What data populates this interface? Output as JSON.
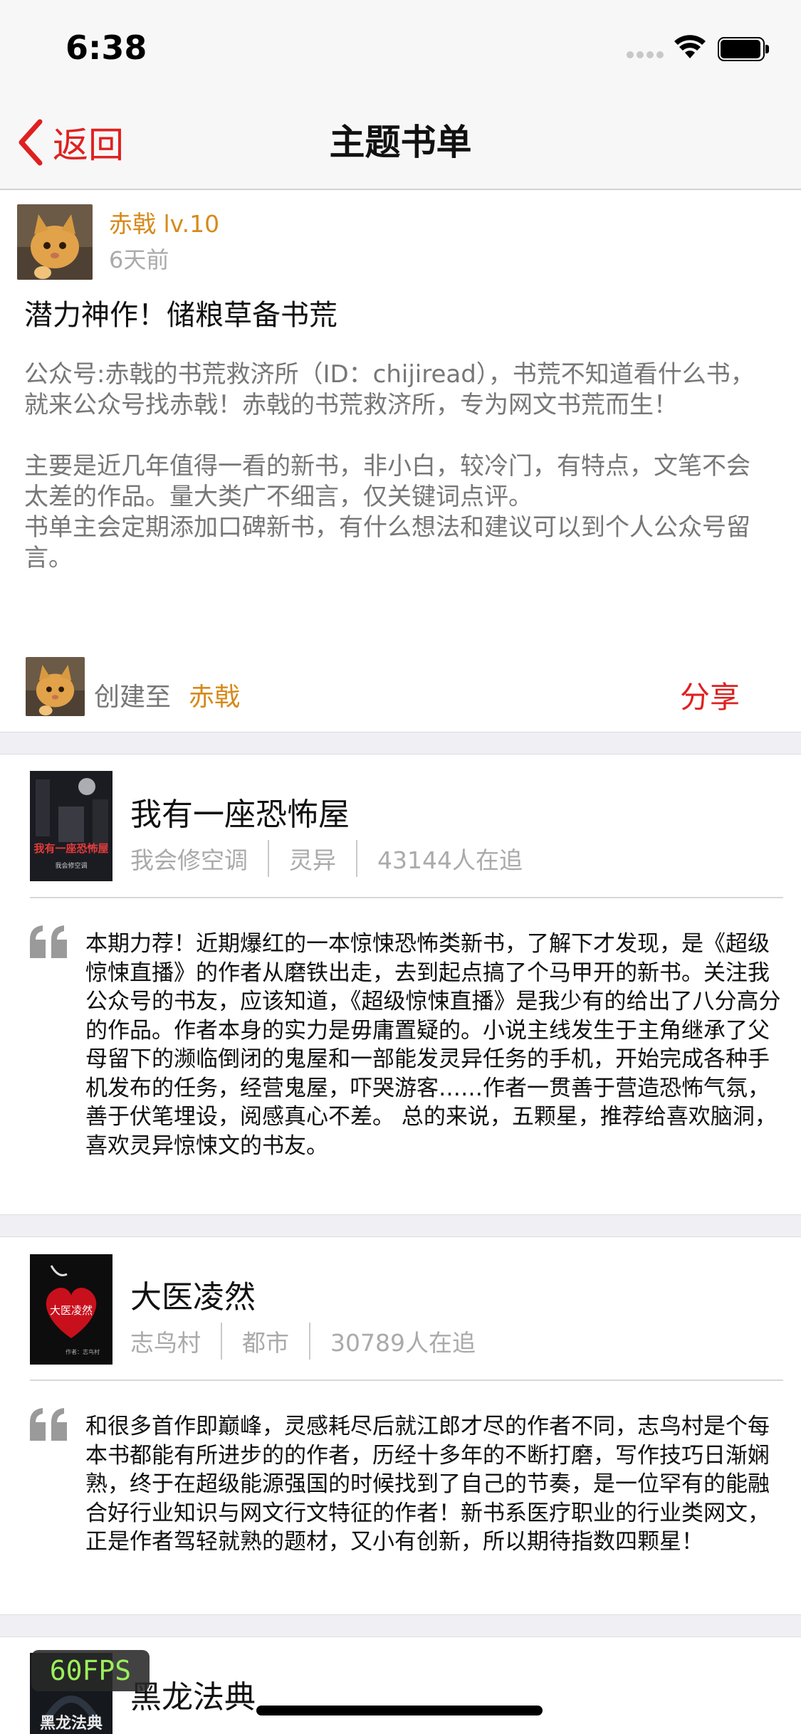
{
  "status_bar": {
    "time": "6:38"
  },
  "nav": {
    "back_label": "返回",
    "title": "主题书单"
  },
  "header": {
    "user_name": "赤戟 lv.10",
    "time_ago": "6天前",
    "list_title": "潜力神作！储粮草备书荒",
    "description": [
      "公众号:赤戟的书荒救济所（ID：chijiread），书荒不知道看什么书，就来公众号找赤戟！赤戟的书荒救济所，专为网文书荒而生！",
      "主要是近几年值得一看的新书，非小白，较冷门，有特点，文笔不会太差的作品。量大类广不细言，仅关键词点评。",
      "书单主会定期添加口碑新书，有什么想法和建议可以到个人公众号留言。"
    ],
    "created_label": "创建至",
    "creator": "赤戟",
    "share_label": "分享"
  },
  "books": [
    {
      "title": "我有一座恐怖屋",
      "author": "我会修空调",
      "category": "灵异",
      "followers": "43144人在追",
      "cover_text": "我有一座恐怖屋",
      "cover_sub": "我会修空调",
      "review": "本期力荐！近期爆红的一本惊悚恐怖类新书，了解下才发现，是《超级惊悚直播》的作者从磨铁出走，去到起点搞了个马甲开的新书。关注我公众号的书友，应该知道，《超级惊悚直播》是我少有的给出了八分高分的作品。作者本身的实力是毋庸置疑的。小说主线发生于主角继承了父母留下的濒临倒闭的鬼屋和一部能发灵异任务的手机，开始完成各种手机发布的任务，经营鬼屋，吓哭游客……作者一贯善于营造恐怖气氛，善于伏笔埋设，阅感真心不差。 总的来说，五颗星，推荐给喜欢脑洞，喜欢灵异惊悚文的书友。"
    },
    {
      "title": "大医凌然",
      "author": "志鸟村",
      "category": "都市",
      "followers": "30789人在追",
      "cover_text": "大医凌然",
      "cover_sub": "作者：志鸟村",
      "review": "和很多首作即巅峰，灵感耗尽后就江郎才尽的作者不同，志鸟村是个每本书都能有所进步的的作者，历经十多年的不断打磨，写作技巧日渐娴熟，终于在超级能源强国的时候找到了自己的节奏，是一位罕有的能融合好行业知识与网文行文特征的作者！新书系医疗职业的行业类网文，正是作者驾轻就熟的题材，又小有创新，所以期待指数四颗星！"
    },
    {
      "title": "黑龙法典",
      "cover_text": "黑龙法典"
    }
  ],
  "overlay": {
    "fps": "60FPS"
  },
  "colors": {
    "accent_red": "#e02020",
    "user_gold": "#d68a1b"
  }
}
